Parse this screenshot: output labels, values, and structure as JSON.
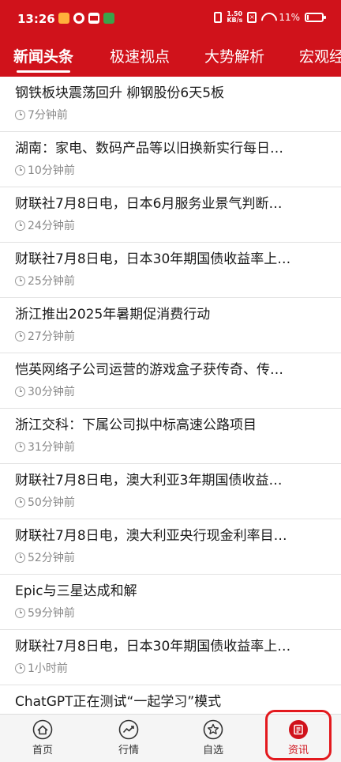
{
  "status_bar": {
    "time": "13:26",
    "speed_value": "1.50",
    "speed_unit": "KB/s",
    "battery": "11%",
    "battery_level": 0.11
  },
  "tabs": [
    {
      "label": "新闻头条",
      "active": true
    },
    {
      "label": "极速视点",
      "active": false
    },
    {
      "label": "大势解析",
      "active": false
    },
    {
      "label": "宏观经",
      "active": false
    }
  ],
  "news": [
    {
      "title": "钢铁板块震荡回升 柳钢股份6天5板",
      "time": "7分钟前"
    },
    {
      "title": "湖南：家电、数码产品等以旧换新实行每日…",
      "time": "10分钟前"
    },
    {
      "title": "财联社7月8日电，日本6月服务业景气判断…",
      "time": "24分钟前"
    },
    {
      "title": "财联社7月8日电，日本30年期国债收益率上…",
      "time": "25分钟前"
    },
    {
      "title": "浙江推出2025年暑期促消费行动",
      "time": "27分钟前"
    },
    {
      "title": "恺英网络子公司运营的游戏盒子获传奇、传…",
      "time": "30分钟前"
    },
    {
      "title": "浙江交科：下属公司拟中标高速公路项目",
      "time": "31分钟前"
    },
    {
      "title": "财联社7月8日电，澳大利亚3年期国债收益…",
      "time": "50分钟前"
    },
    {
      "title": "财联社7月8日电，澳大利亚央行现金利率目…",
      "time": "52分钟前"
    },
    {
      "title": "Epic与三星达成和解",
      "time": "59分钟前"
    },
    {
      "title": "财联社7月8日电，日本30年期国债收益率上…",
      "time": "1小时前"
    },
    {
      "title": "ChatGPT正在测试“一起学习”模式",
      "time": ""
    }
  ],
  "bottom_nav": [
    {
      "label": "首页",
      "icon": "home-icon"
    },
    {
      "label": "行情",
      "icon": "chart-icon"
    },
    {
      "label": "自选",
      "icon": "star-icon"
    },
    {
      "label": "资讯",
      "icon": "news-icon"
    }
  ],
  "colors": {
    "brand_red": "#d0121b",
    "highlight_frame": "#e3191e"
  }
}
